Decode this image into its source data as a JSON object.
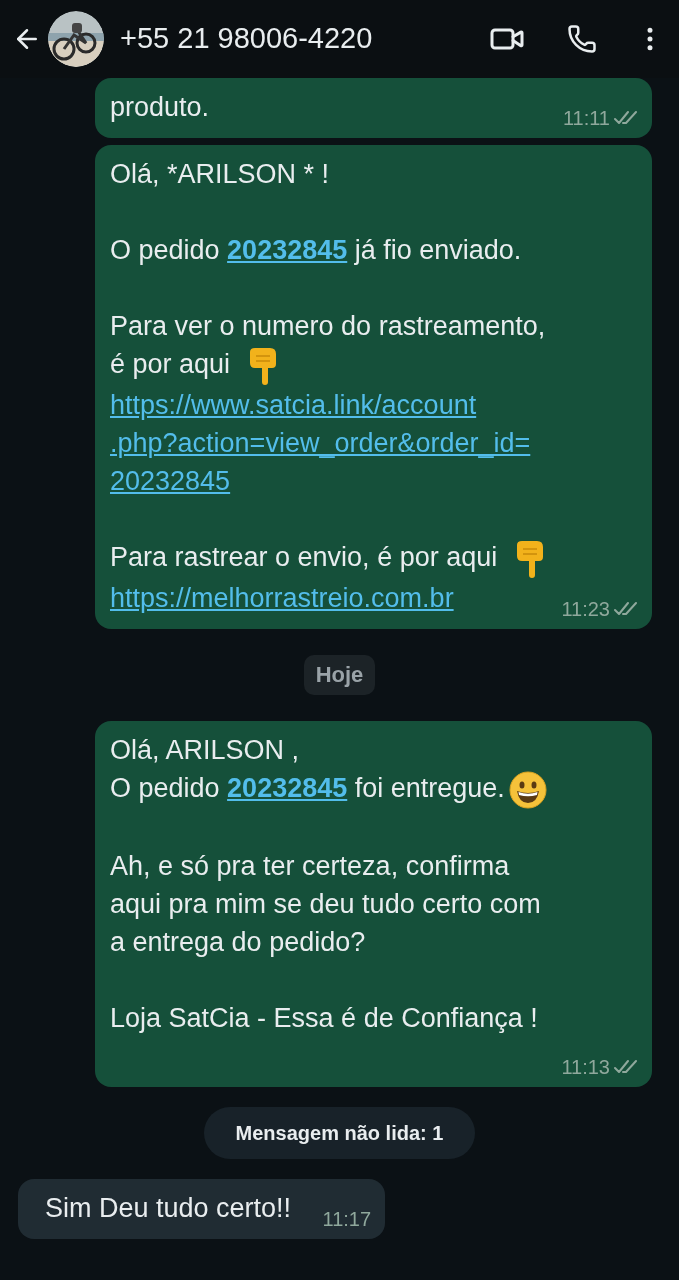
{
  "header": {
    "contact": "+55 21 98006-4220"
  },
  "messages": [
    {
      "kind": "outgoing",
      "time": "11:11",
      "read": false,
      "paragraphs": [
        {
          "lines": [
            [
              {
                "kind": "text",
                "text": "produto."
              }
            ]
          ]
        }
      ]
    },
    {
      "kind": "outgoing",
      "time": "11:23",
      "read": false,
      "paragraphs": [
        {
          "lines": [
            [
              {
                "kind": "text",
                "text": "Olá, *ARILSON * !"
              }
            ]
          ]
        },
        {
          "lines": [
            [
              {
                "kind": "text",
                "text": "O pedido "
              },
              {
                "kind": "order-link",
                "lines": [
                  "20232845"
                ]
              },
              {
                "kind": "text",
                "text": " já fio enviado."
              }
            ]
          ]
        },
        {
          "lines": [
            [
              {
                "kind": "text",
                "text": "Para ver o numero do rastreamento,"
              }
            ],
            [
              {
                "kind": "text",
                "text": "é por aqui"
              },
              {
                "kind": "hand"
              }
            ],
            [
              {
                "kind": "link",
                "lines": [
                  "https://www.satcia.link/account",
                  ".php?action=view_order&order_id=",
                  "20232845"
                ]
              }
            ]
          ]
        },
        {
          "lines": [
            [
              {
                "kind": "text",
                "text": "Para rastrear o envio, é por aqui"
              },
              {
                "kind": "hand"
              }
            ],
            [
              {
                "kind": "link",
                "lines": [
                  "https://melhorrastreio.com.br"
                ]
              }
            ]
          ]
        }
      ]
    },
    {
      "kind": "date",
      "text": "Hoje"
    },
    {
      "kind": "outgoing",
      "time": "11:13",
      "read": false,
      "paragraphs": [
        {
          "lines": [
            [
              {
                "kind": "text",
                "text": "Olá, ARILSON ,"
              }
            ],
            [
              {
                "kind": "text",
                "text": "O pedido "
              },
              {
                "kind": "order-link",
                "lines": [
                  "20232845"
                ]
              },
              {
                "kind": "text",
                "text": " foi entregue."
              },
              {
                "kind": "smiley"
              }
            ]
          ]
        },
        {
          "lines": [
            [
              {
                "kind": "text",
                "text": "Ah, e só pra ter certeza, confirma\naqui pra mim se deu tudo certo com\na entrega do pedido?"
              }
            ]
          ]
        },
        {
          "lines": [
            [
              {
                "kind": "text",
                "text": "Loja SatCia - Essa é de Confiança !"
              }
            ]
          ]
        }
      ]
    },
    {
      "kind": "unread",
      "text": "Mensagem não lida: 1"
    },
    {
      "kind": "incoming",
      "time": "11:17",
      "paragraphs": [
        {
          "lines": [
            [
              {
                "kind": "text",
                "text": "Sim Deu tudo certo!!"
              }
            ]
          ]
        }
      ]
    }
  ]
}
